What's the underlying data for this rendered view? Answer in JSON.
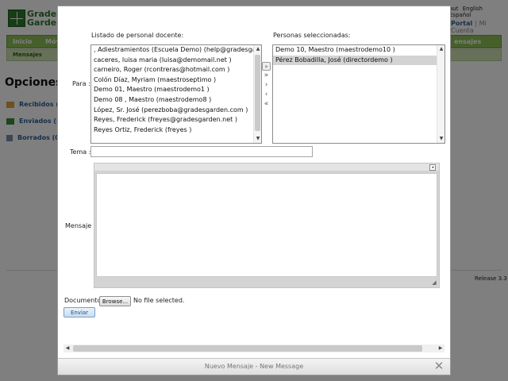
{
  "background": {
    "logo_text_top": "Grade",
    "logo_text_bottom": "Garde",
    "lang_links": [
      "aut",
      "English",
      "Español"
    ],
    "portal_link": "Portal",
    "portal_sep": "|",
    "mi_cuenta_link": "Mi Cuenta",
    "nav_items": [
      "Inicio",
      "Móv",
      "ensajes"
    ],
    "subnav_item": "Mensajes",
    "opciones_title": "Opciones",
    "folders": [
      {
        "label": "Recibidos (4",
        "icon": "folder-icon"
      },
      {
        "label": "Enviados (59",
        "icon": "sent-icon"
      },
      {
        "label": "Borrados (0",
        "icon": "trash-icon"
      }
    ],
    "release": "Release 3.3"
  },
  "dialog": {
    "title": "Nuevo Mensaje - New Message",
    "staff_list_label": "Listado de personal docente:",
    "selected_list_label": "Personas seleccionadas:",
    "para_label": "Para :",
    "tema_label": "Tema :",
    "mensaje_label": "Mensaje",
    "documento_label": "Documento",
    "browse_label": "Browse...",
    "file_status": "No file selected.",
    "send_label": "Enviar",
    "tema_value": "",
    "message_value": "",
    "staff": [
      ", Adiestramientos (Escuela Demo) (help@gradesgarden.",
      "caceres, luisa maria (luisa@demomail.net )",
      "carneiro, Roger (rcontreras@hotmail.com )",
      "Colón Díaz, Myriam (maestroseptimo )",
      "Demo 01, Maestro (maestrodemo1 )",
      "Demo 08 , Maestro (maestrodemo8 )",
      "López, Sr. José (perezboba@gradesgarden.com )",
      "Reyes, Frederick (freyes@gradesgarden.net )",
      "Reyes Ortiz, Frederick (freyes )"
    ],
    "selected": [
      "Demo 10, Maestro (maestrodemo10 )",
      "Pérez Bobadilla, José (directordemo )"
    ],
    "selected_highlight_index": 1,
    "move_buttons": [
      "add-all-icon",
      "add-all-double-icon",
      "add-one-icon",
      "remove-one-icon",
      "remove-all-icon"
    ],
    "colors": {
      "nav_green": "#8fbf56",
      "accent_blue": "#2d5e99"
    }
  }
}
